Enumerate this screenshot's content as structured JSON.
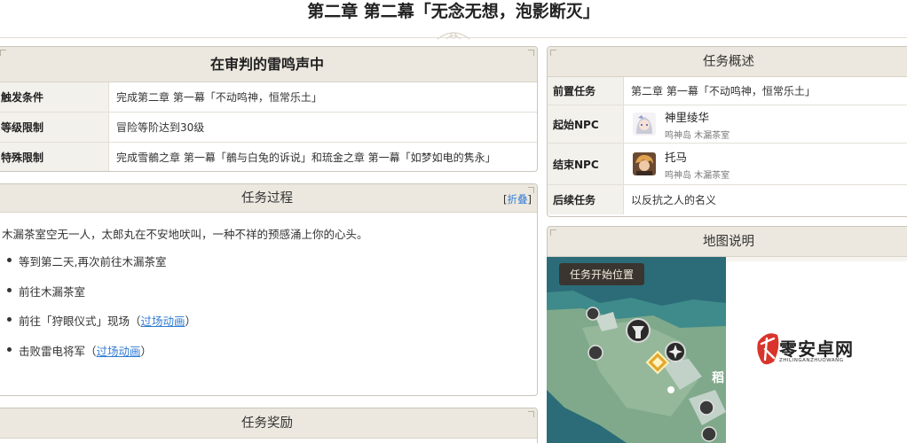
{
  "page": {
    "title": "第二章 第二幕「无念无想，泡影断灭」"
  },
  "quest_info": {
    "name": "在审判的雷鸣声中",
    "rows": [
      {
        "key": "触发条件",
        "value": "完成第二章 第一幕「不动鸣神，恒常乐土」"
      },
      {
        "key": "等级限制",
        "value": "冒险等阶达到30级"
      },
      {
        "key": "特殊限制",
        "value": "完成雪鶺之章 第一幕「鶺与白兔的诉说」和琉金之章 第一幕「如梦如电的隽永」"
      }
    ]
  },
  "overview": {
    "title": "任务概述",
    "prev_key": "前置任务",
    "prev_value": "第二章 第一幕「不动鸣神，恒常乐土」",
    "start_key": "起始NPC",
    "start_npc": {
      "name": "神里绫华",
      "location": "鸣神岛 木漏茶室",
      "icon": "ayaka-avatar-icon"
    },
    "end_key": "结束NPC",
    "end_npc": {
      "name": "托马",
      "location": "鸣神岛 木漏茶室",
      "icon": "thoma-avatar-icon"
    },
    "next_key": "后续任务",
    "next_value": "以反抗之人的名义"
  },
  "process": {
    "title": "任务过程",
    "fold_open": "[",
    "fold_label": "折叠",
    "fold_close": "]",
    "intro": "木漏茶室空无一人，太郎丸在不安地吠叫，一种不祥的预感涌上你的心头。",
    "steps": [
      {
        "text": "等到第二天,再次前往木漏茶室",
        "paren_open": "",
        "link": "",
        "paren_close": ""
      },
      {
        "text": "前往木漏茶室",
        "paren_open": "",
        "link": "",
        "paren_close": ""
      },
      {
        "text": "前往「狩眼仪式」现场",
        "paren_open": "（",
        "link": "过场动画",
        "paren_close": "）"
      },
      {
        "text": "击败雷电将军",
        "paren_open": "（",
        "link": "过场动画",
        "paren_close": "）"
      }
    ]
  },
  "rewards": {
    "title": "任务奖励"
  },
  "map": {
    "title": "地图说明",
    "start_label": "任务开始位置",
    "char_glyph": "稻"
  },
  "watermark": {
    "text": "零安卓网",
    "subtext": "ZHILINGANZHUOWANG",
    "logo_char": "九"
  },
  "colors": {
    "header_bg": "#ece8df",
    "border": "#cbc6bb",
    "link": "#2f7bd4",
    "map_water": "#2a6a76",
    "watermark_red": "#d9342b"
  }
}
